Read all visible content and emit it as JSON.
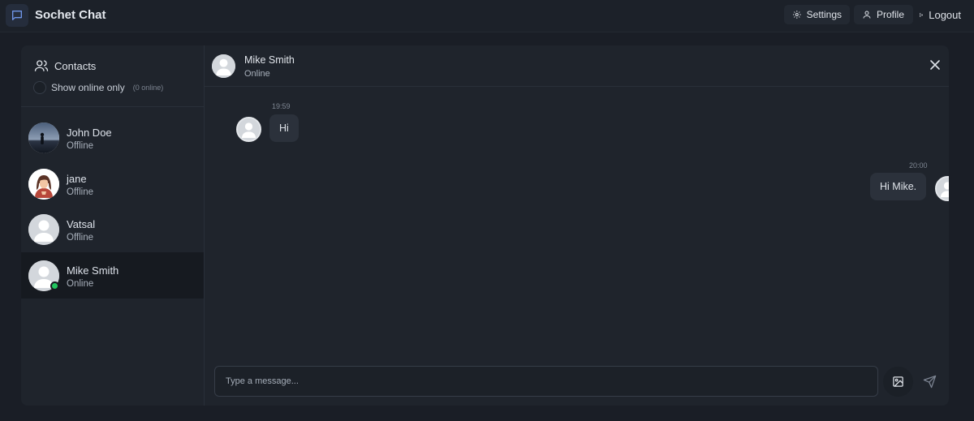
{
  "app": {
    "title": "Sochet Chat",
    "logo_icon": "chat-bubble-icon"
  },
  "topbar": {
    "settings_label": "Settings",
    "profile_label": "Profile",
    "logout_label": "Logout"
  },
  "sidebar": {
    "title": "Contacts",
    "online_toggle_label": "Show online only",
    "online_count": "(0 online)",
    "contacts": [
      {
        "name": "John Doe",
        "status": "Offline",
        "avatar": "photo-silhouette"
      },
      {
        "name": "jane",
        "status": "Offline",
        "avatar": "photo-woman"
      },
      {
        "name": "Vatsal",
        "status": "Offline",
        "avatar": "default-user"
      },
      {
        "name": "Mike Smith",
        "status": "Online",
        "avatar": "default-user",
        "active": true
      }
    ]
  },
  "chat": {
    "contact_name": "Mike Smith",
    "contact_status": "Online",
    "messages": [
      {
        "direction": "incoming",
        "time": "19:59",
        "text": "Hi"
      },
      {
        "direction": "outgoing",
        "time": "20:00",
        "text": "Hi Mike."
      }
    ],
    "input_placeholder": "Type a message..."
  },
  "colors": {
    "background": "#1a1e26",
    "panel": "#1f242c",
    "bubble": "#2b313b",
    "online": "#22c55e",
    "accent": "#5b8def"
  }
}
